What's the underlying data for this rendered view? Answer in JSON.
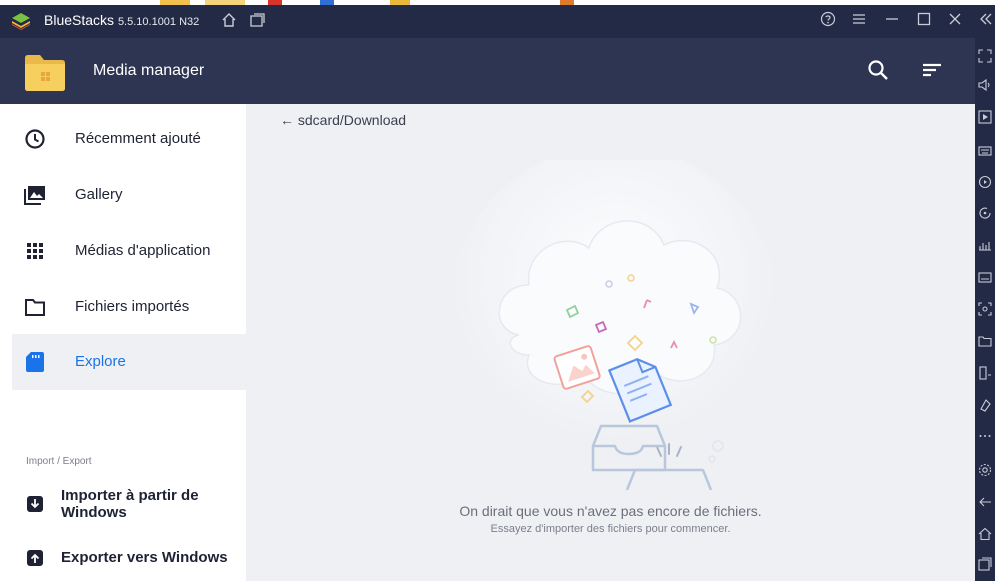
{
  "window": {
    "app_name": "BlueStacks",
    "version": "5.5.10.1001 N32",
    "icons": [
      "home-icon",
      "multi-instance-icon",
      "help-icon",
      "menu-icon",
      "minimize-icon",
      "maximize-icon",
      "close-icon",
      "collapse-sidebar-icon"
    ]
  },
  "header": {
    "title": "Media manager",
    "icons": [
      "folder-icon",
      "search-icon",
      "sort-icon"
    ]
  },
  "nav": {
    "items": [
      {
        "label": "Récemment ajouté",
        "icon": "clock-icon"
      },
      {
        "label": "Gallery",
        "icon": "gallery-icon"
      },
      {
        "label": "Médias d'application",
        "icon": "grid-icon"
      },
      {
        "label": "Fichiers importés",
        "icon": "folder-outline-icon"
      },
      {
        "label": "Explore",
        "icon": "sdcard-icon",
        "active": true
      }
    ],
    "section_label": "Import / Export",
    "actions": [
      {
        "label": "Importer à partir de Windows",
        "icon": "import-icon"
      },
      {
        "label": "Exporter vers Windows",
        "icon": "export-icon"
      }
    ]
  },
  "main": {
    "breadcrumb": "← sdcard/Download",
    "empty_title": "On dirait que vous n'avez pas encore de fichiers.",
    "empty_subtitle": "Essayez d'importer des fichiers pour commencer."
  },
  "right_toolbar": {
    "icons": [
      "fullscreen-icon",
      "volume-icon",
      "media-icon",
      "keyboard-icon",
      "macro-icon",
      "rotate-icon",
      "performance-icon",
      "apk-icon",
      "screenshot-icon",
      "folder-icon",
      "multi-instance-icon",
      "erase-icon",
      "more-icon",
      "settings-icon",
      "back-icon",
      "home-icon",
      "recent-apps-icon"
    ]
  },
  "colors": {
    "titlebar": "#232a45",
    "appbar": "#2e3552",
    "accent": "#1a73e8",
    "content_bg": "#eef0f4"
  }
}
